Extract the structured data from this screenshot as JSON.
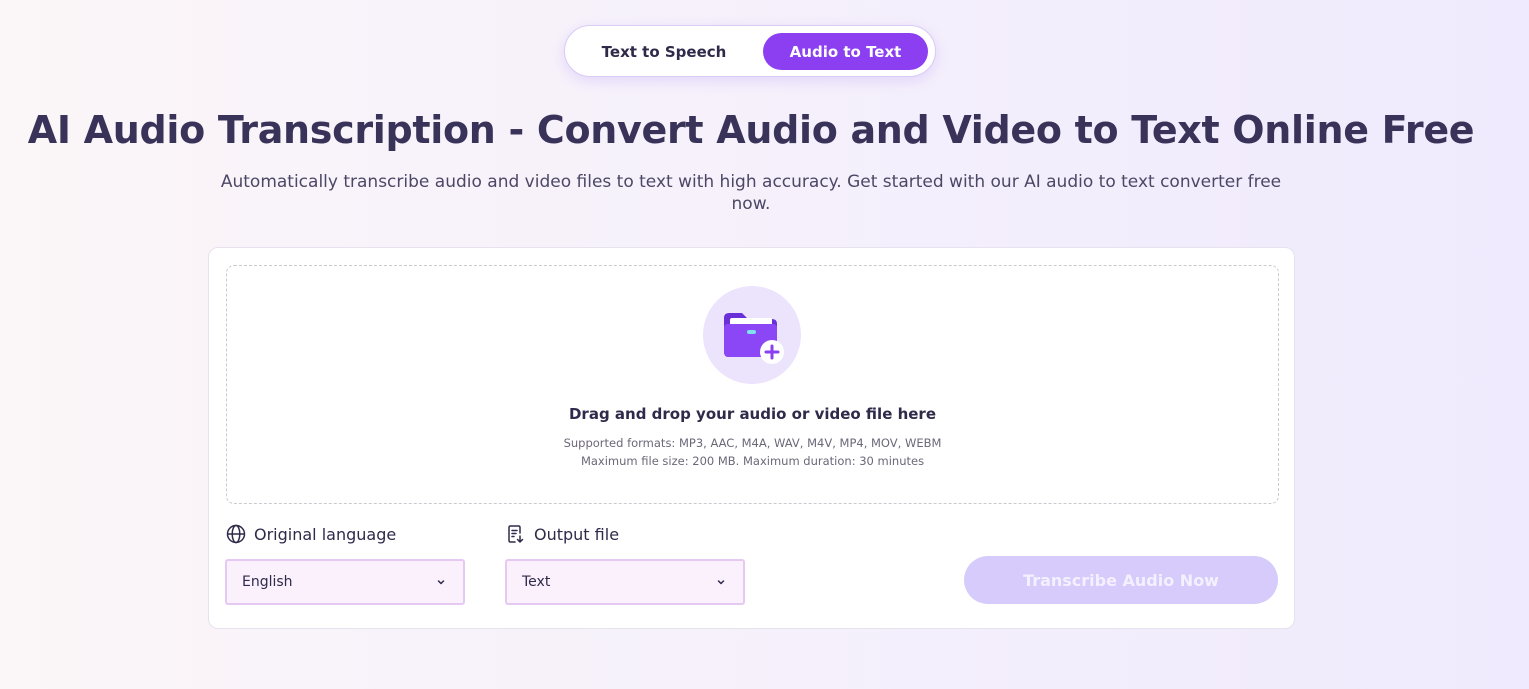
{
  "tabs": {
    "text_to_speech": "Text to Speech",
    "audio_to_text": "Audio to Text",
    "active": "audio_to_text"
  },
  "header": {
    "title": "AI Audio Transcription - Convert Audio and Video to Text Online Free",
    "subtitle": "Automatically transcribe audio and video files to text with high accuracy. Get started with our AI audio to text converter free now."
  },
  "upload": {
    "icon": "folder-plus-icon",
    "prompt": "Drag and drop your audio or video file here",
    "formats": "Supported formats: MP3, AAC, M4A, WAV, M4V, MP4, MOV, WEBM",
    "limits": "Maximum file size: 200 MB. Maximum duration: 30 minutes"
  },
  "options": {
    "language": {
      "icon": "globe-icon",
      "label": "Original language",
      "value": "English"
    },
    "output": {
      "icon": "document-download-icon",
      "label": "Output file",
      "value": "Text"
    }
  },
  "actions": {
    "transcribe": "Transcribe Audio Now"
  },
  "colors": {
    "accent": "#8b3ff0",
    "button_disabled": "#d6cbfb",
    "select_bg": "#faf1fd",
    "select_border": "#e6c9f3",
    "title_text": "#3a3359"
  }
}
